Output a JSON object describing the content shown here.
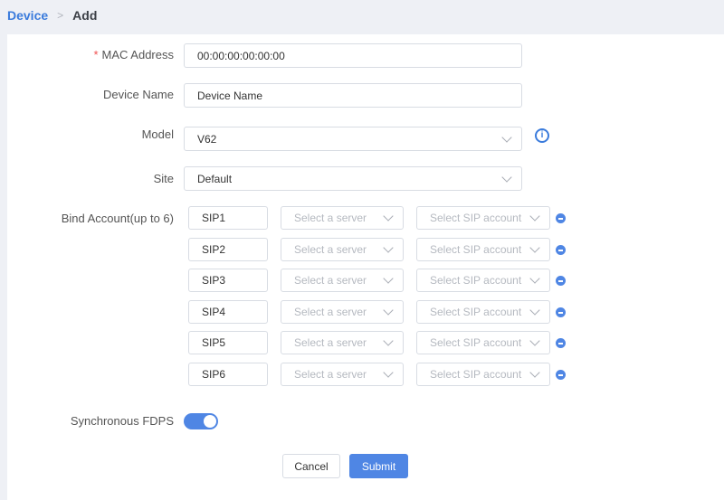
{
  "breadcrumb": {
    "parent": "Device",
    "current": "Add"
  },
  "form": {
    "mac": {
      "label": "MAC Address",
      "required_mark": "*",
      "value": "00:00:00:00:00:00"
    },
    "device_name": {
      "label": "Device Name",
      "value": "Device Name"
    },
    "model": {
      "label": "Model",
      "value": "V62"
    },
    "site": {
      "label": "Site",
      "value": "Default"
    },
    "bind_account": {
      "label": "Bind Account(up to 6)",
      "server_placeholder": "Select a server",
      "account_placeholder": "Select SIP account",
      "accounts": [
        {
          "name": "SIP1"
        },
        {
          "name": "SIP2"
        },
        {
          "name": "SIP3"
        },
        {
          "name": "SIP4"
        },
        {
          "name": "SIP5"
        },
        {
          "name": "SIP6"
        }
      ]
    },
    "sync_fdps": {
      "label": "Synchronous FDPS",
      "enabled": true
    }
  },
  "buttons": {
    "cancel": "Cancel",
    "submit": "Submit"
  },
  "colors": {
    "accent": "#4f86e4",
    "link": "#3a7bdc",
    "required": "#f05050"
  },
  "icons": {
    "info": "info-circle-icon",
    "remove": "minus-circle-icon",
    "chevron": "chevron-down-icon"
  }
}
